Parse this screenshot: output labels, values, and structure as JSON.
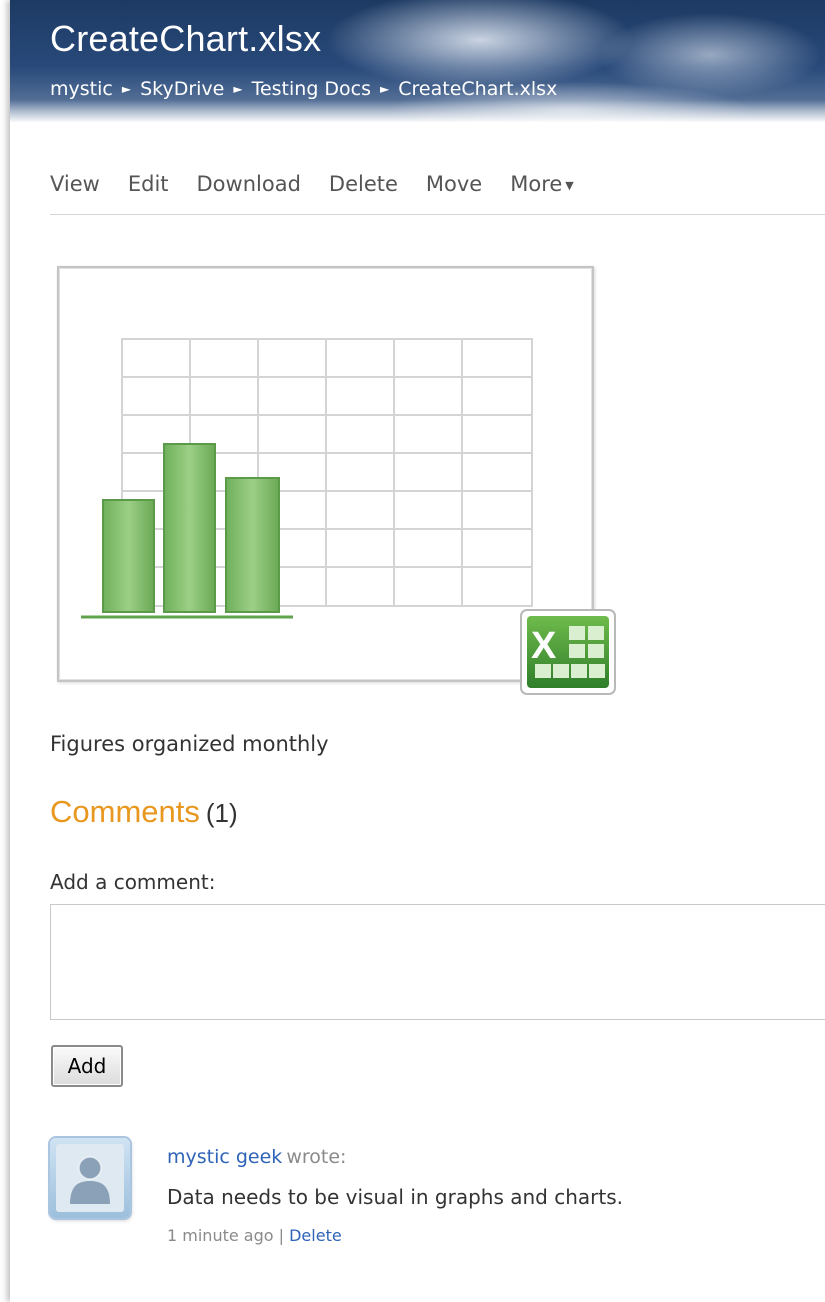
{
  "header": {
    "title": "CreateChart.xlsx",
    "breadcrumb": [
      "mystic",
      "SkyDrive",
      "Testing Docs",
      "CreateChart.xlsx"
    ]
  },
  "actions": {
    "view": "View",
    "edit": "Edit",
    "download": "Download",
    "delete": "Delete",
    "move": "Move",
    "more": "More"
  },
  "file": {
    "icon": "excel-spreadsheet-icon",
    "description": "Figures organized monthly"
  },
  "comments": {
    "title": "Comments",
    "count": "(1)",
    "add_label": "Add a comment:",
    "input_value": "",
    "add_button": "Add",
    "items": [
      {
        "author": "mystic geek",
        "wrote": "wrote:",
        "text": "Data needs to be visual in graphs and charts.",
        "time": "1 minute ago",
        "separator": "|",
        "delete_label": "Delete"
      }
    ]
  },
  "colors": {
    "header_bg": "#28497a",
    "comments_accent": "#e8971f",
    "link": "#2f63b8",
    "chart_green": "#7fbf6a"
  }
}
